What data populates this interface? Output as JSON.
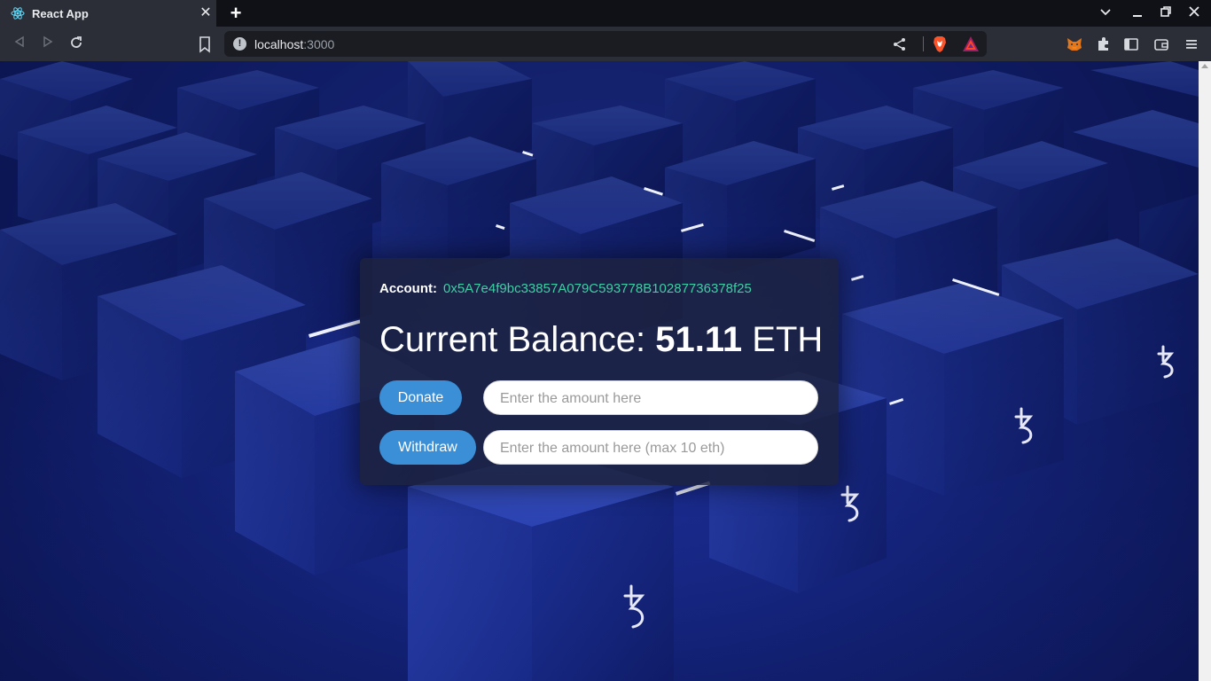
{
  "browser": {
    "tab_title": "React App",
    "url_host": "localhost",
    "url_port": ":3000",
    "window_controls": {
      "dropdown": "⌄",
      "minimize": "—",
      "restore": "❐",
      "close": "✕"
    }
  },
  "app": {
    "account_label": "Account:",
    "account_address": "0x5A7e4f9bc33857A079C593778B10287736378f25",
    "balance_prefix": "Current Balance: ",
    "balance_amount": "51.11",
    "balance_unit": " ETH",
    "donate_label": "Donate",
    "donate_placeholder": "Enter the amount here",
    "withdraw_label": "Withdraw",
    "withdraw_placeholder": "Enter the amount here (max 10 eth)"
  },
  "colors": {
    "accent_button": "#3b8fd6",
    "account_text": "#3fcfa4",
    "card_bg": "rgba(28,34,62,0.86)"
  }
}
